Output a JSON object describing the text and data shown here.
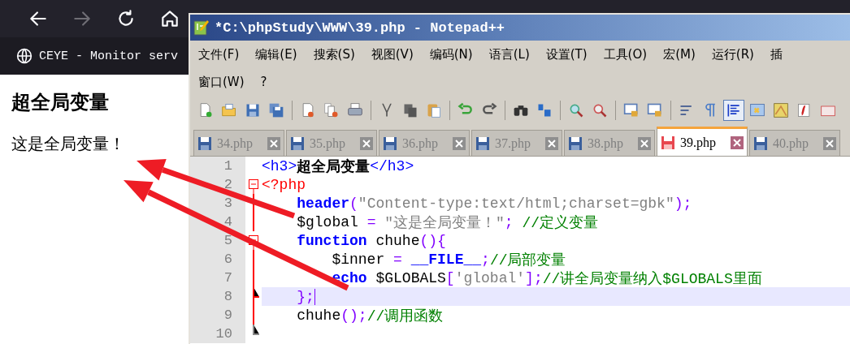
{
  "browser": {
    "nav": [
      {
        "kind": "back",
        "disabled": false
      },
      {
        "kind": "forward",
        "disabled": true
      },
      {
        "kind": "reload",
        "disabled": false
      },
      {
        "kind": "home",
        "disabled": false
      }
    ],
    "bookmark": "CEYE - Monitor serv",
    "heading": "超全局变量",
    "paragraph": "这是全局变量！"
  },
  "window": {
    "title": "*C:\\phpStudy\\WWW\\39.php - Notepad++",
    "menu_rows": [
      [
        "文件(F)",
        "编辑(E)",
        "搜索(S)",
        "视图(V)",
        "编码(N)",
        "语言(L)",
        "设置(T)",
        "工具(O)",
        "宏(M)",
        "运行(R)",
        "插"
      ],
      [
        "窗口(W)",
        "?"
      ]
    ],
    "tabs": [
      {
        "label": "34.php",
        "selected": false,
        "modified": false
      },
      {
        "label": "35.php",
        "selected": false,
        "modified": false
      },
      {
        "label": "36.php",
        "selected": false,
        "modified": false
      },
      {
        "label": "37.php",
        "selected": false,
        "modified": false
      },
      {
        "label": "38.php",
        "selected": false,
        "modified": false
      },
      {
        "label": "39.php",
        "selected": true,
        "modified": true
      },
      {
        "label": "40.php",
        "selected": false,
        "modified": false
      }
    ],
    "editor": {
      "lines": [
        {
          "number": "1",
          "kind": "plain",
          "current": false,
          "tokens": [
            {
              "kind": "tag",
              "text": "<h3>"
            },
            {
              "kind": "bold",
              "text": "超全局变量"
            },
            {
              "kind": "tag",
              "text": "</h3>"
            }
          ]
        },
        {
          "number": "2",
          "kind": "fold_start",
          "current": false,
          "tokens": [
            {
              "kind": "delim",
              "text": "<?php"
            }
          ]
        },
        {
          "number": "3",
          "kind": "fold_body",
          "current": false,
          "tokens": [
            {
              "kind": "keyword",
              "text": "    header"
            },
            {
              "kind": "op",
              "text": "("
            },
            {
              "kind": "string",
              "text": "\"Content-type:text/html;charset=gbk\""
            },
            {
              "kind": "op",
              "text": ");"
            }
          ]
        },
        {
          "number": "4",
          "kind": "fold_body",
          "current": false,
          "tokens": [
            {
              "kind": "plain",
              "text": "    $global "
            },
            {
              "kind": "op",
              "text": "="
            },
            {
              "kind": "string",
              "text": " \"这是全局变量！\""
            },
            {
              "kind": "op",
              "text": "; "
            },
            {
              "kind": "comment",
              "text": "//定义变量"
            }
          ]
        },
        {
          "number": "5",
          "kind": "fold_start",
          "current": false,
          "tokens": [
            {
              "kind": "keyword",
              "text": "    function"
            },
            {
              "kind": "plain",
              "text": " chuhe"
            },
            {
              "kind": "op",
              "text": "(){"
            }
          ]
        },
        {
          "number": "6",
          "kind": "fold_body",
          "current": false,
          "tokens": [
            {
              "kind": "plain",
              "text": "        $inner "
            },
            {
              "kind": "op",
              "text": "= "
            },
            {
              "kind": "keyword",
              "text": "__FILE__"
            },
            {
              "kind": "op",
              "text": ";"
            },
            {
              "kind": "comment",
              "text": "//局部变量"
            }
          ]
        },
        {
          "number": "7",
          "kind": "fold_body",
          "current": false,
          "tokens": [
            {
              "kind": "keyword",
              "text": "        echo"
            },
            {
              "kind": "plain",
              "text": " $GLOBALS"
            },
            {
              "kind": "op",
              "text": "["
            },
            {
              "kind": "string",
              "text": "'global'"
            },
            {
              "kind": "op",
              "text": "];"
            },
            {
              "kind": "comment",
              "text": "//讲全局变量纳入$GLOBALS里面"
            }
          ]
        },
        {
          "number": "8",
          "kind": "fold_end",
          "current": true,
          "tokens": [
            {
              "kind": "op",
              "text": "    };"
            }
          ]
        },
        {
          "number": "9",
          "kind": "fold_body",
          "current": false,
          "tokens": [
            {
              "kind": "plain",
              "text": "    chuhe"
            },
            {
              "kind": "op",
              "text": "();"
            },
            {
              "kind": "comment",
              "text": "//调用函数"
            }
          ]
        },
        {
          "number": "10",
          "kind": "fold_last",
          "current": false
        }
      ]
    }
  }
}
